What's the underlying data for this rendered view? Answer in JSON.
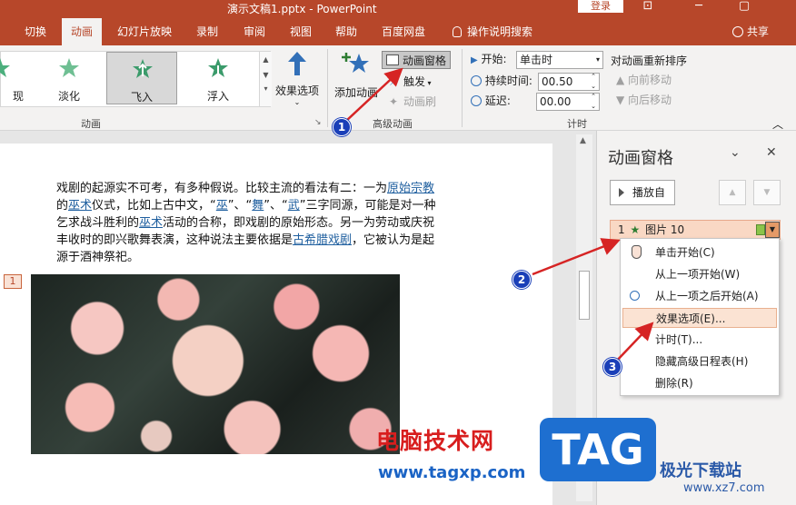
{
  "titlebar": {
    "doc_title": "演示文稿1.pptx  -  PowerPoint",
    "login": "登录"
  },
  "tabs": [
    {
      "label": "切换"
    },
    {
      "label": "动画"
    },
    {
      "label": "幻灯片放映"
    },
    {
      "label": "录制"
    },
    {
      "label": "审阅"
    },
    {
      "label": "视图"
    },
    {
      "label": "帮助"
    },
    {
      "label": "百度网盘"
    }
  ],
  "tell_me": "操作说明搜索",
  "share": "共享",
  "ribbon": {
    "gallery": [
      {
        "label": "现",
        "color": "#3b9b6b"
      },
      {
        "label": "淡化",
        "color": "#3b9b6b"
      },
      {
        "label": "飞入",
        "color": "#3b9b6b"
      },
      {
        "label": "浮入",
        "color": "#3b9b6b"
      }
    ],
    "effect_options": "效果选项",
    "group_animation": "动画",
    "add_animation": "添加动画",
    "animation_pane": "动画窗格",
    "trigger": "触发",
    "animation_painter": "动画刷",
    "group_advanced": "高级动画",
    "start_label": "开始:",
    "start_value": "单击时",
    "duration_label": "持续时间:",
    "duration_value": "00.50",
    "delay_label": "延迟:",
    "delay_value": "00.00",
    "group_timing": "计时",
    "reorder_title": "对动画重新排序",
    "move_earlier": "向前移动",
    "move_later": "向后移动"
  },
  "slide": {
    "paragraph": [
      {
        "t": "戏剧的起源实不可考，有多种假说。比较主流的看法有二：一为",
        "link": false
      },
      {
        "t": "原始宗教",
        "link": true
      },
      {
        "t": "的",
        "link": false
      },
      {
        "t": "巫术",
        "link": true
      },
      {
        "t": "仪式，比如上古中文，“",
        "link": false
      },
      {
        "t": "巫",
        "link": true
      },
      {
        "t": "”、“",
        "link": false
      },
      {
        "t": "舞",
        "link": true
      },
      {
        "t": "”、“",
        "link": false
      },
      {
        "t": "武",
        "link": true
      },
      {
        "t": "”三字同源，可能是对一种乞求战斗胜利的",
        "link": false
      },
      {
        "t": "巫术",
        "link": true
      },
      {
        "t": "活动的合称，即戏剧的原始形态。另一为劳动或庆祝丰收时的即兴歌舞表演，这种说法主要依据是",
        "link": false
      },
      {
        "t": "古希腊戏剧",
        "link": true
      },
      {
        "t": "，它被认为是起源于酒神祭祀。",
        "link": false
      }
    ],
    "anim_tag": "1"
  },
  "pane": {
    "title": "动画窗格",
    "play": "播放自",
    "item_index": "1",
    "item_name": "图片 10",
    "menu": [
      {
        "label": "单击开始(C)",
        "icon": "mouse"
      },
      {
        "label": "从上一项开始(W)",
        "icon": ""
      },
      {
        "label": "从上一项之后开始(A)",
        "icon": "clock"
      },
      {
        "label": "效果选项(E)...",
        "icon": ""
      },
      {
        "label": "计时(T)...",
        "icon": ""
      },
      {
        "label": "隐藏高级日程表(H)",
        "icon": ""
      },
      {
        "label": "删除(R)",
        "icon": ""
      }
    ]
  },
  "callouts": [
    "1",
    "2",
    "3"
  ],
  "colors": {
    "accent": "#b7472a",
    "callout": "#1a3fb8",
    "arrow": "#d62424"
  },
  "watermark": {
    "cn": "电脑技术网",
    "url": "www.tagxp.com",
    "tag": "TAG",
    "logo": "极光下载站",
    "logo_url": "www.xz7.com"
  }
}
